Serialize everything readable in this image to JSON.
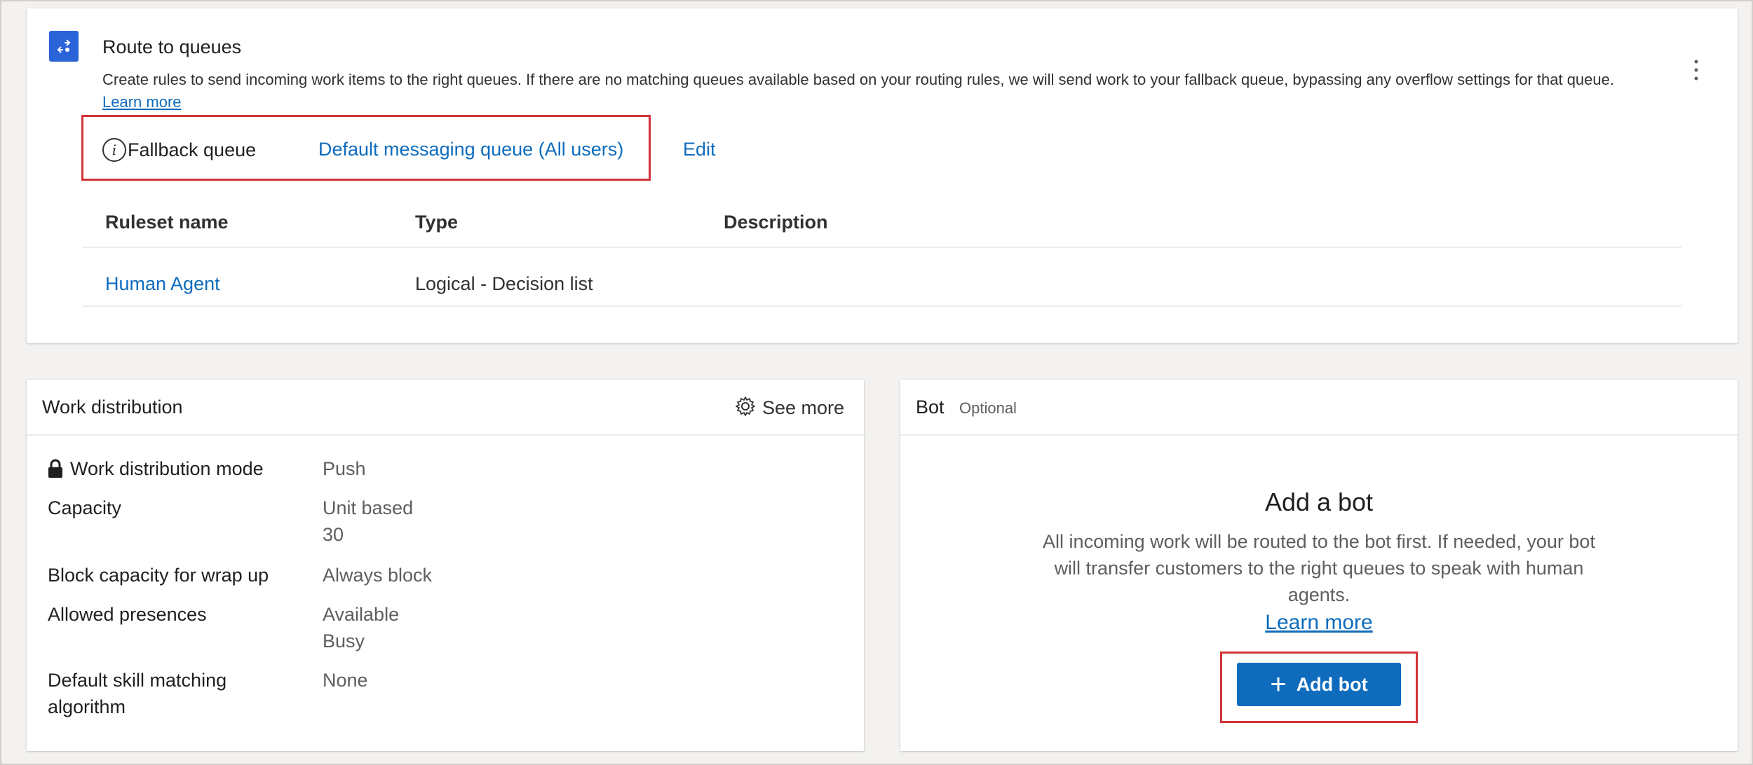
{
  "route": {
    "title": "Route to queues",
    "description": "Create rules to send incoming work items to the right queues. If there are no matching queues available based on your routing rules, we will send work to your fallback queue, bypassing any overflow settings for that queue.",
    "learn_more": "Learn more",
    "fallback_label": "Fallback queue",
    "fallback_queue": "Default messaging queue (All users)",
    "edit_label": "Edit",
    "table": {
      "headers": [
        "Ruleset name",
        "Type",
        "Description"
      ],
      "rows": [
        {
          "name": "Human Agent",
          "type": "Logical - Decision list",
          "description": ""
        }
      ]
    }
  },
  "work_distribution": {
    "title": "Work distribution",
    "see_more": "See more",
    "fields": [
      {
        "label": "Work distribution mode",
        "values": [
          "Push"
        ]
      },
      {
        "label": "Capacity",
        "values": [
          "Unit based",
          "30"
        ]
      },
      {
        "label": "Block capacity for wrap up",
        "values": [
          "Always block"
        ]
      },
      {
        "label": "Allowed presences",
        "values": [
          "Available",
          "Busy"
        ]
      },
      {
        "label": "Default skill matching algorithm",
        "values": [
          "None"
        ]
      }
    ]
  },
  "bot": {
    "title": "Bot",
    "optional": "Optional",
    "heading": "Add a bot",
    "description": "All incoming work will be routed to the bot first. If needed, your bot will transfer customers to the right queues to speak with human agents.",
    "learn_more": "Learn more",
    "add_button": "Add bot"
  },
  "icons": {
    "route": "route-queues-icon",
    "info": "info-icon",
    "more": "more-vertical-icon",
    "gear": "gear-icon",
    "lock": "lock-icon",
    "plus": "plus-icon"
  },
  "colors": {
    "accent": "#0f6cbd",
    "highlight": "#d13438",
    "route_icon": "#2b64d9"
  }
}
